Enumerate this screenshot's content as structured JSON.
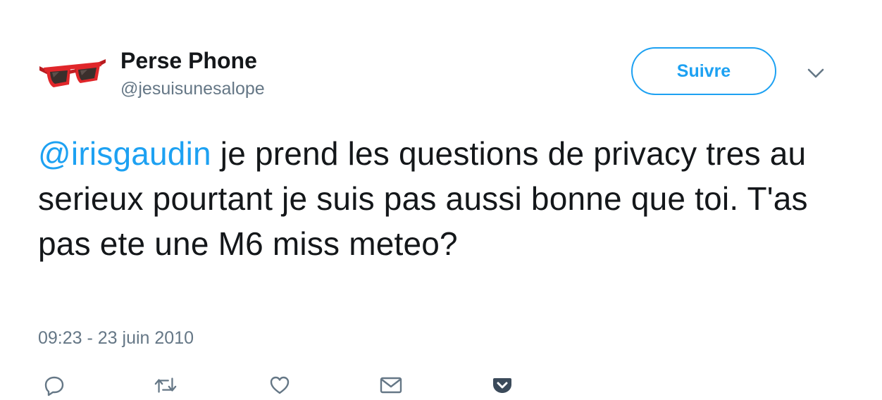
{
  "user": {
    "display_name": "Perse Phone",
    "handle": "@jesuisunesalope",
    "avatar_icon": "red-sunglasses-icon"
  },
  "follow_button": {
    "label": "Suivre"
  },
  "menu": {
    "icon": "chevron-down-icon"
  },
  "tweet": {
    "mention": "@irisgaudin",
    "text": " je prend les questions de privacy tres au serieux pourtant je suis pas aussi bonne que toi. T'as pas ete une M6 miss meteo?",
    "timestamp": "09:23 - 23 juin 2010"
  },
  "actions": [
    {
      "name": "reply",
      "icon": "reply-icon"
    },
    {
      "name": "retweet",
      "icon": "retweet-icon"
    },
    {
      "name": "like",
      "icon": "heart-icon"
    },
    {
      "name": "message",
      "icon": "envelope-icon"
    },
    {
      "name": "pocket",
      "icon": "pocket-icon"
    }
  ],
  "colors": {
    "accent": "#1da1f2",
    "text": "#14171a",
    "secondary_text": "#657786",
    "icon_gray": "#657786",
    "pocket": "#3b4a5a",
    "sunglasses_red": "#e0262a"
  }
}
